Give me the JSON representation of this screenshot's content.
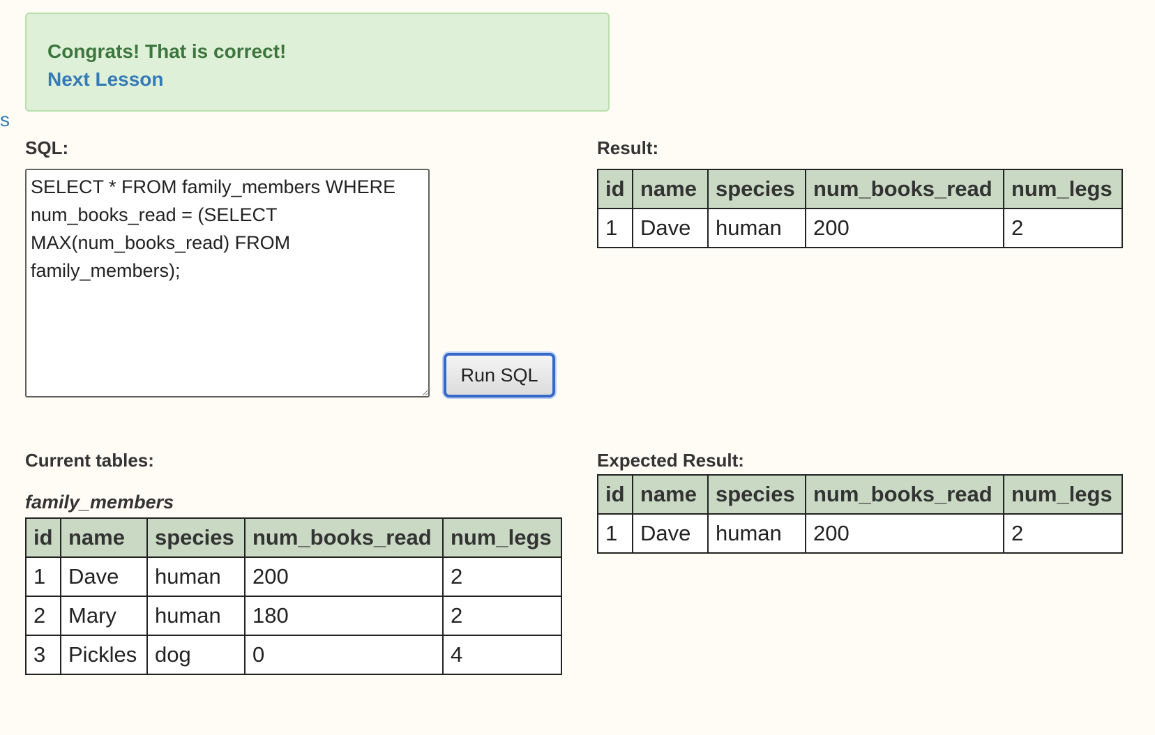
{
  "feedback": {
    "message": "Congrats! That is correct!",
    "next_link": "Next Lesson",
    "edge_fragment": "s"
  },
  "editor": {
    "label": "SQL:",
    "query": "SELECT * FROM family_members WHERE num_books_read = (SELECT MAX(num_books_read) FROM family_members);",
    "run_button": "Run SQL"
  },
  "result": {
    "label": "Result:",
    "columns": [
      "id",
      "name",
      "species",
      "num_books_read",
      "num_legs"
    ],
    "rows": [
      [
        "1",
        "Dave",
        "human",
        "200",
        "2"
      ]
    ]
  },
  "current_tables": {
    "label": "Current tables:",
    "table_name": "family_members",
    "columns": [
      "id",
      "name",
      "species",
      "num_books_read",
      "num_legs"
    ],
    "rows": [
      [
        "1",
        "Dave",
        "human",
        "200",
        "2"
      ],
      [
        "2",
        "Mary",
        "human",
        "180",
        "2"
      ],
      [
        "3",
        "Pickles",
        "dog",
        "0",
        "4"
      ]
    ]
  },
  "expected": {
    "label": "Expected Result:",
    "columns": [
      "id",
      "name",
      "species",
      "num_books_read",
      "num_legs"
    ],
    "rows": [
      [
        "1",
        "Dave",
        "human",
        "200",
        "2"
      ]
    ]
  },
  "colors": {
    "success_bg": "#dff0d8",
    "success_text": "#3c763d",
    "link": "#337ab7",
    "header_bg": "#c9d9c3",
    "page_bg": "#fffcf6",
    "focus_ring": "#3568c9"
  }
}
